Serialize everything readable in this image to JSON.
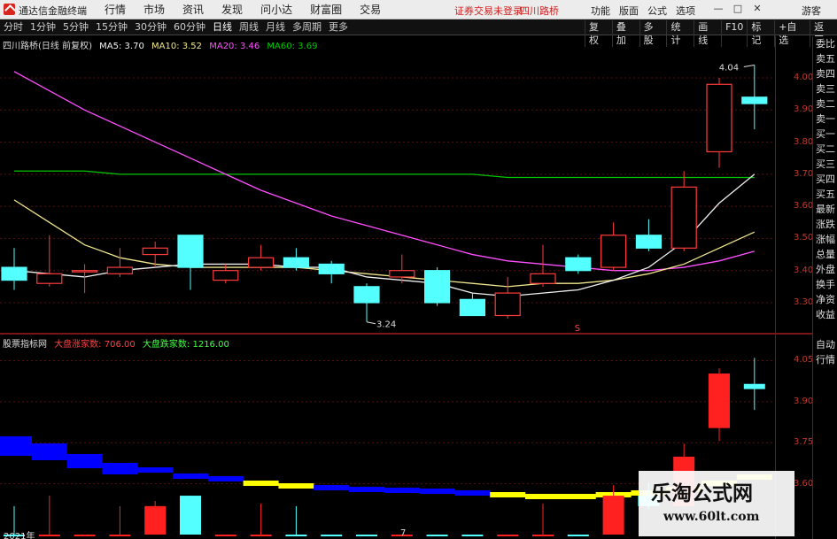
{
  "window": {
    "app_name": "通达信金融终端",
    "menu": [
      "行情",
      "市场",
      "资讯",
      "发现",
      "问小达",
      "财富圈",
      "交易"
    ],
    "status": "证券交易未登录",
    "stock_name": "四川路桥",
    "right_menu": [
      "功能",
      "版面",
      "公式",
      "选项"
    ],
    "guest": "游客",
    "win_buttons": [
      "—",
      "□",
      "✕"
    ]
  },
  "toolbar": {
    "periods": [
      "分时",
      "1分钟",
      "5分钟",
      "15分钟",
      "30分钟",
      "60分钟",
      "日线",
      "周线",
      "月线",
      "多周期",
      "更多"
    ],
    "active_period": "日线",
    "tools": [
      "复权",
      "叠加",
      "多股",
      "统计",
      "画线",
      "F10",
      "标记",
      "+自选",
      "返回"
    ]
  },
  "main_chart": {
    "header_title": "四川路桥(日线 前复权)",
    "ma5": "MA5: 3.70",
    "ma10": "MA10: 3.52",
    "ma20": "MA20: 3.46",
    "ma60": "MA60: 3.69",
    "high_label": "4.04",
    "low_label": "3.24",
    "marker_s": "S",
    "colors": {
      "up": "#ff3b3b",
      "down": "#54ffff",
      "ma5": "#f0f0f0",
      "ma10": "#f0e68c",
      "ma20": "#ff4fff",
      "ma60": "#00c800",
      "grid": "#5a1010",
      "axis": "#c0392b"
    }
  },
  "indicator_chart": {
    "header_name": "股票指标网",
    "dec_label": "大盘涨家数: 706.00",
    "inc_label": "大盘跌家数: 1216.00"
  },
  "right_strip": [
    "委比",
    "卖五",
    "卖四",
    "卖三",
    "卖二",
    "卖一",
    "买一",
    "买二",
    "买三",
    "买四",
    "买五",
    "最新",
    "涨跌",
    "涨幅",
    "总量",
    "外盘",
    "换手",
    "净资",
    "收益",
    "",
    "自动",
    "行情"
  ],
  "bottom": {
    "year": "2021年",
    "month": "7"
  },
  "watermark": {
    "line1": "乐淘公式网",
    "line2": "www.60lt.com"
  },
  "chart_data": {
    "type": "candlestick",
    "ylim": [
      3.22,
      4.08
    ],
    "y_ticks": [
      4.0,
      3.9,
      3.8,
      3.7,
      3.6,
      3.5,
      3.4,
      3.3
    ],
    "candles": [
      {
        "o": 3.41,
        "c": 3.37,
        "h": 3.47,
        "l": 3.34
      },
      {
        "o": 3.36,
        "c": 3.39,
        "h": 3.51,
        "l": 3.35
      },
      {
        "o": 3.4,
        "c": 3.4,
        "h": 3.42,
        "l": 3.33
      },
      {
        "o": 3.39,
        "c": 3.41,
        "h": 3.47,
        "l": 3.38
      },
      {
        "o": 3.45,
        "c": 3.47,
        "h": 3.49,
        "l": 3.41
      },
      {
        "o": 3.51,
        "c": 3.41,
        "h": 3.51,
        "l": 3.34
      },
      {
        "o": 3.37,
        "c": 3.4,
        "h": 3.42,
        "l": 3.36
      },
      {
        "o": 3.41,
        "c": 3.44,
        "h": 3.48,
        "l": 3.4
      },
      {
        "o": 3.44,
        "c": 3.41,
        "h": 3.47,
        "l": 3.4
      },
      {
        "o": 3.42,
        "c": 3.39,
        "h": 3.43,
        "l": 3.36
      },
      {
        "o": 3.35,
        "c": 3.3,
        "h": 3.36,
        "l": 3.24
      },
      {
        "o": 3.38,
        "c": 3.4,
        "h": 3.45,
        "l": 3.36
      },
      {
        "o": 3.4,
        "c": 3.3,
        "h": 3.41,
        "l": 3.29
      },
      {
        "o": 3.31,
        "c": 3.26,
        "h": 3.33,
        "l": 3.26
      },
      {
        "o": 3.26,
        "c": 3.33,
        "h": 3.38,
        "l": 3.25
      },
      {
        "o": 3.36,
        "c": 3.39,
        "h": 3.48,
        "l": 3.35
      },
      {
        "o": 3.44,
        "c": 3.4,
        "h": 3.45,
        "l": 3.39
      },
      {
        "o": 3.41,
        "c": 3.51,
        "h": 3.55,
        "l": 3.4
      },
      {
        "o": 3.51,
        "c": 3.47,
        "h": 3.56,
        "l": 3.46
      },
      {
        "o": 3.47,
        "c": 3.66,
        "h": 3.71,
        "l": 3.46
      },
      {
        "o": 3.77,
        "c": 3.98,
        "h": 4.0,
        "l": 3.72
      },
      {
        "o": 3.94,
        "c": 3.92,
        "h": 4.04,
        "l": 3.84
      }
    ],
    "ma5": [
      3.4,
      3.39,
      3.38,
      3.4,
      3.41,
      3.42,
      3.42,
      3.42,
      3.41,
      3.41,
      3.38,
      3.37,
      3.36,
      3.33,
      3.32,
      3.33,
      3.34,
      3.37,
      3.41,
      3.49,
      3.61,
      3.7
    ],
    "ma10": [
      3.62,
      3.55,
      3.48,
      3.44,
      3.42,
      3.41,
      3.41,
      3.41,
      3.41,
      3.4,
      3.39,
      3.38,
      3.37,
      3.36,
      3.35,
      3.36,
      3.36,
      3.37,
      3.39,
      3.42,
      3.47,
      3.52
    ],
    "ma20": [
      4.02,
      3.96,
      3.9,
      3.85,
      3.8,
      3.75,
      3.7,
      3.65,
      3.61,
      3.57,
      3.54,
      3.51,
      3.48,
      3.45,
      3.43,
      3.42,
      3.41,
      3.4,
      3.4,
      3.41,
      3.43,
      3.46
    ],
    "ma60": [
      3.71,
      3.71,
      3.71,
      3.7,
      3.7,
      3.7,
      3.7,
      3.7,
      3.7,
      3.7,
      3.7,
      3.7,
      3.7,
      3.7,
      3.69,
      3.69,
      3.69,
      3.69,
      3.69,
      3.69,
      3.69,
      3.69
    ],
    "indicator": {
      "ylim": [
        3.45,
        4.1
      ],
      "y_ticks": [
        4.05,
        3.9,
        3.75,
        3.6
      ]
    }
  }
}
